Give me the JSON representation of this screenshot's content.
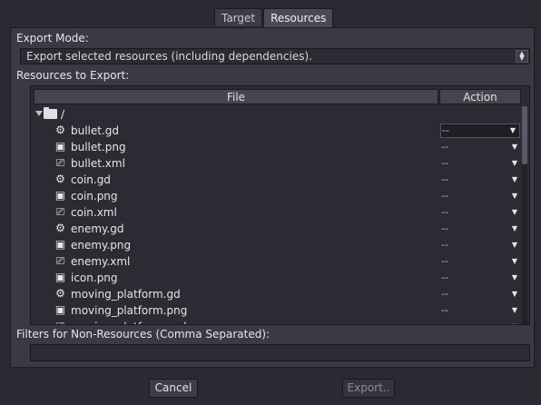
{
  "tabs": [
    {
      "label": "Target",
      "active": false
    },
    {
      "label": "Resources",
      "active": true
    }
  ],
  "export_mode": {
    "label": "Export Mode:",
    "value": "Export selected resources (including dependencies)."
  },
  "resources": {
    "label": "Resources to Export:",
    "columns": {
      "file": "File",
      "action": "Action"
    },
    "root": "/",
    "items": [
      {
        "icon": "gear-icon",
        "name": "bullet.gd",
        "action": "--",
        "selected": true
      },
      {
        "icon": "image-icon",
        "name": "bullet.png",
        "action": "--"
      },
      {
        "icon": "scene-icon",
        "name": "bullet.xml",
        "action": "--"
      },
      {
        "icon": "gear-icon",
        "name": "coin.gd",
        "action": "--"
      },
      {
        "icon": "image-icon",
        "name": "coin.png",
        "action": "--"
      },
      {
        "icon": "scene-icon",
        "name": "coin.xml",
        "action": "--"
      },
      {
        "icon": "gear-icon",
        "name": "enemy.gd",
        "action": "--"
      },
      {
        "icon": "image-icon",
        "name": "enemy.png",
        "action": "--"
      },
      {
        "icon": "scene-icon",
        "name": "enemy.xml",
        "action": "--"
      },
      {
        "icon": "image-icon",
        "name": "icon.png",
        "action": "--"
      },
      {
        "icon": "gear-icon",
        "name": "moving_platform.gd",
        "action": "--"
      },
      {
        "icon": "image-icon",
        "name": "moving_platform.png",
        "action": "--"
      },
      {
        "icon": "scene-icon",
        "name": "moving_platform.xml",
        "action": "--"
      }
    ]
  },
  "filters": {
    "label": "Filters for Non-Resources (Comma Separated):",
    "value": ""
  },
  "buttons": {
    "cancel": "Cancel",
    "export": "Export.."
  }
}
